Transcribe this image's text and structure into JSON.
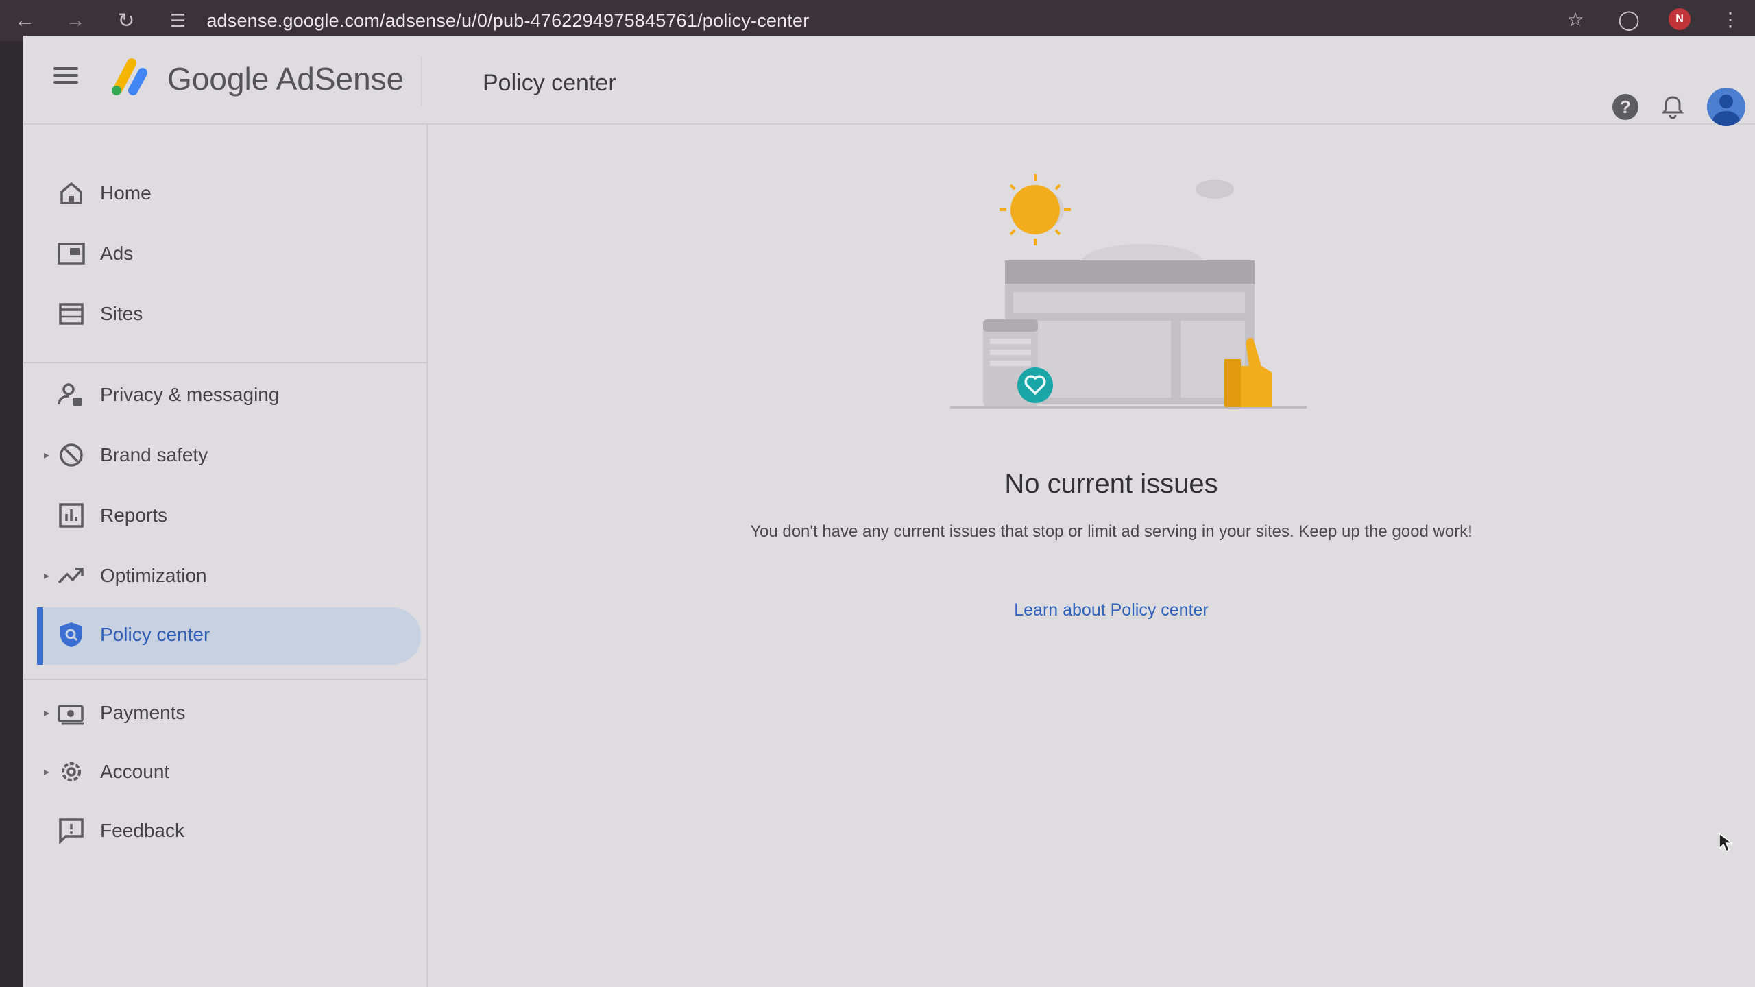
{
  "browser": {
    "url": "adsense.google.com/adsense/u/0/pub-4762294975845761/policy-center",
    "profile_initial": "N"
  },
  "header": {
    "brand": "Google AdSense",
    "page_title": "Policy center"
  },
  "sidebar": {
    "items": [
      {
        "label": "Home",
        "icon": "home-icon"
      },
      {
        "label": "Ads",
        "icon": "ads-icon"
      },
      {
        "label": "Sites",
        "icon": "sites-icon"
      },
      {
        "label": "Privacy & messaging",
        "icon": "privacy-icon"
      },
      {
        "label": "Brand safety",
        "icon": "block-icon"
      },
      {
        "label": "Reports",
        "icon": "bar-chart-icon"
      },
      {
        "label": "Optimization",
        "icon": "trending-icon"
      },
      {
        "label": "Policy center",
        "icon": "policy-shield-icon",
        "active": true
      },
      {
        "label": "Payments",
        "icon": "payments-icon"
      },
      {
        "label": "Account",
        "icon": "gear-icon"
      },
      {
        "label": "Feedback",
        "icon": "feedback-icon"
      }
    ]
  },
  "main": {
    "title": "No current issues",
    "description": "You don't have any current issues that stop or limit ad serving in your sites. Keep up the good work!",
    "link": "Learn about Policy center"
  },
  "colors": {
    "accent": "#3a6fd1",
    "active_bg": "#c7d1e2",
    "link": "#2f62b8",
    "sun": "#f2ad1c",
    "heart_badge": "#1aa6a6"
  }
}
